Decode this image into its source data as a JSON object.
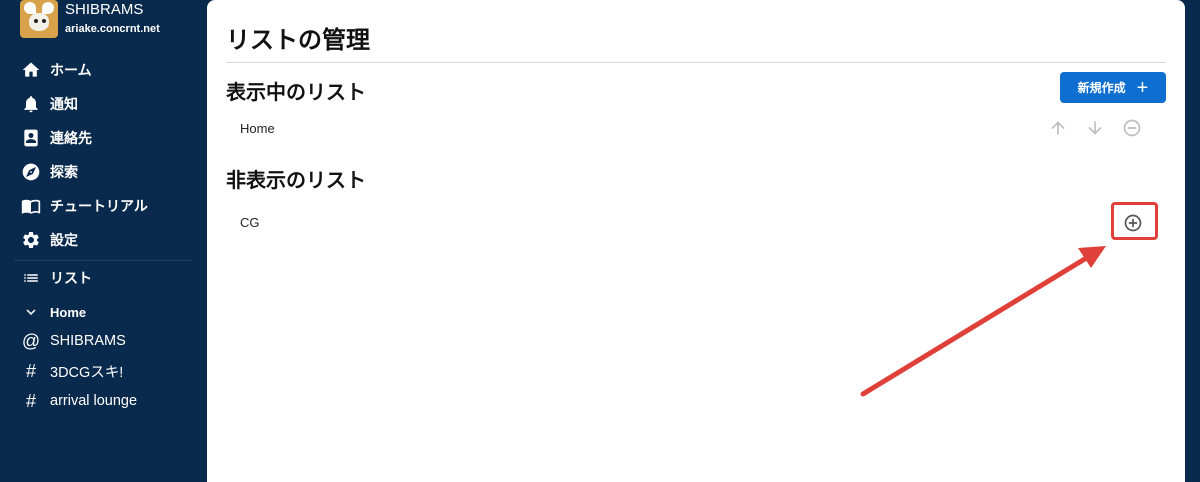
{
  "profile": {
    "name": "SHIBRAMS",
    "host": "ariake.concrnt.net"
  },
  "nav": [
    {
      "label": "ホーム",
      "icon": "home-icon"
    },
    {
      "label": "通知",
      "icon": "bell-icon"
    },
    {
      "label": "連絡先",
      "icon": "contacts-icon"
    },
    {
      "label": "探索",
      "icon": "compass-icon"
    },
    {
      "label": "チュートリアル",
      "icon": "book-icon"
    },
    {
      "label": "設定",
      "icon": "gear-icon"
    }
  ],
  "lists": {
    "header": "リスト",
    "items": [
      {
        "label": "Home",
        "icon": "chevron-down-icon"
      },
      {
        "label": "SHIBRAMS",
        "icon": "at-icon"
      },
      {
        "label": "3DCGスキ!",
        "icon": "hash-icon"
      },
      {
        "label": "arrival lounge",
        "icon": "hash-icon"
      }
    ]
  },
  "main": {
    "title": "リストの管理",
    "visible_section": "表示中のリスト",
    "new_button": "新規作成",
    "visible_lists": [
      {
        "label": "Home"
      }
    ],
    "hidden_section": "非表示のリスト",
    "hidden_lists": [
      {
        "label": "CG"
      }
    ]
  },
  "colors": {
    "sidebar": "#0a2a4d",
    "accent": "#0f6fd1",
    "annotation": "#e0403a"
  }
}
